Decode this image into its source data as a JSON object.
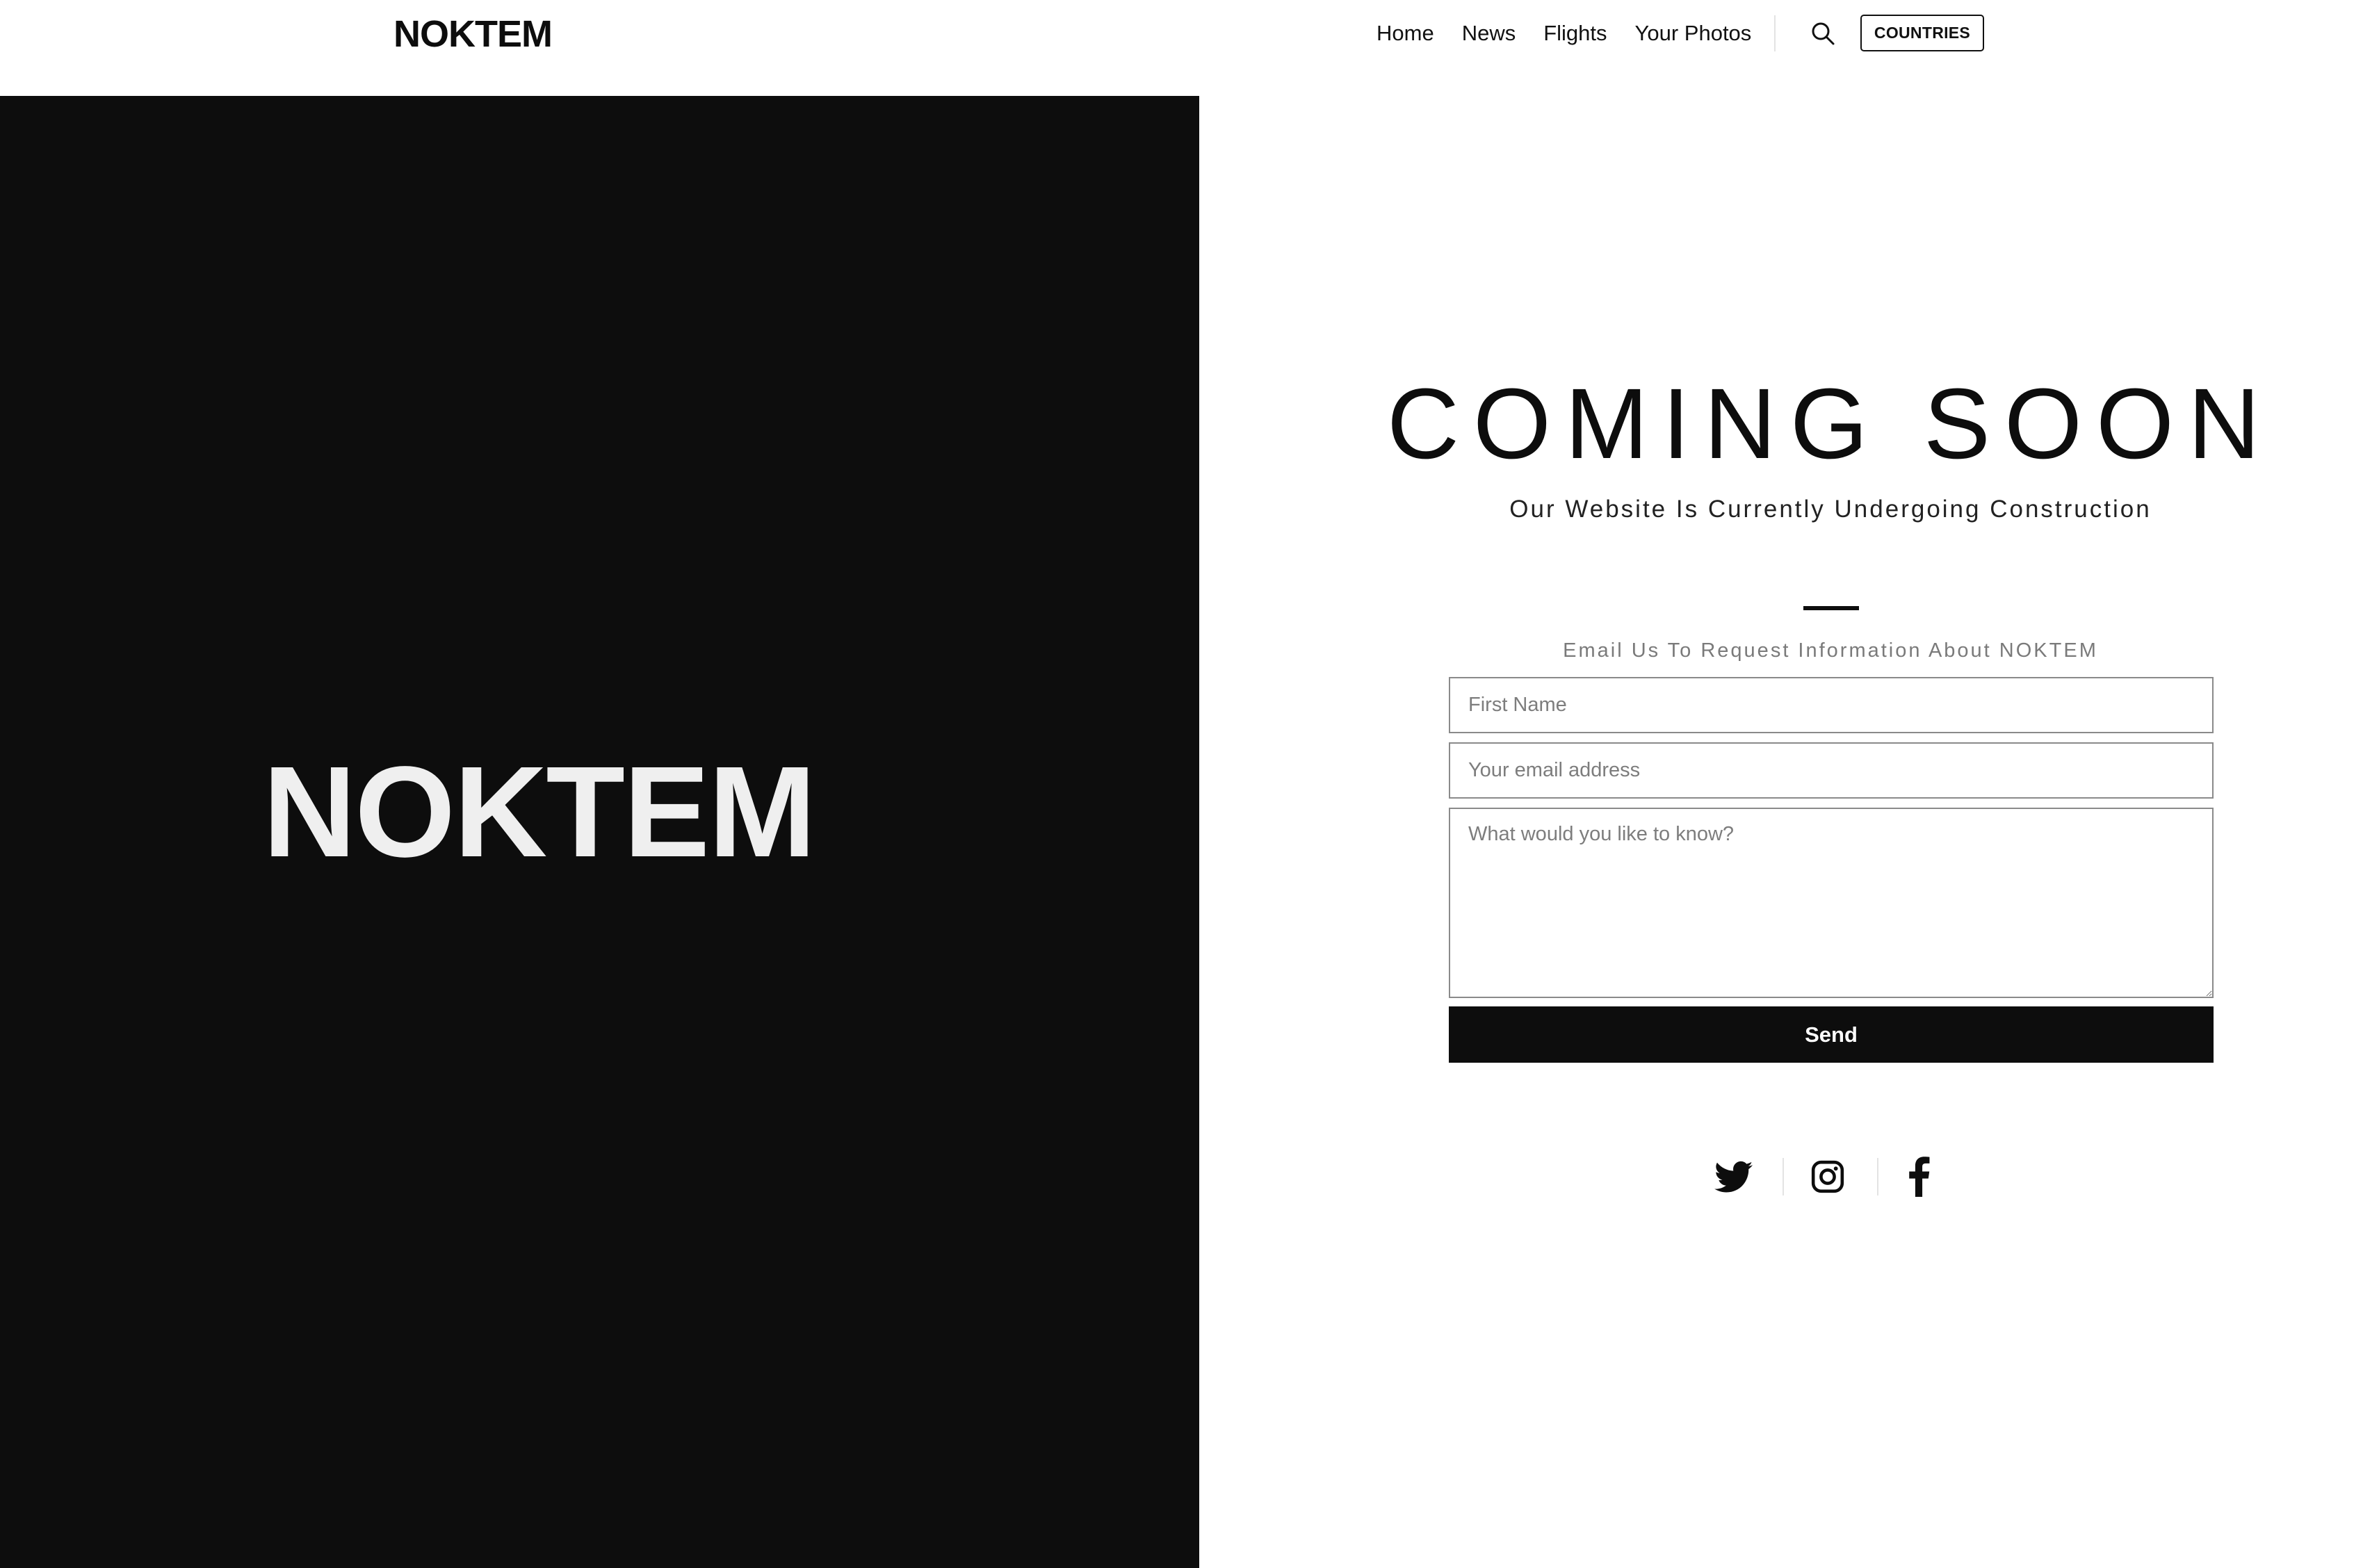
{
  "header": {
    "brand": "NOKTEM",
    "nav": [
      "Home",
      "News",
      "Flights",
      "Your Photos"
    ],
    "search_icon": "search-icon",
    "countries_label": "COUNTRIES"
  },
  "hero": {
    "brand": "NOKTEM",
    "panel_color": "#0d0d0d"
  },
  "main": {
    "title": "COMING SOON",
    "subtitle": "Our Website Is Currently Undergoing Construction",
    "email_prompt": "Email Us To Request Information About NOKTEM",
    "form": {
      "first_name_placeholder": "First Name",
      "email_placeholder": "Your email address",
      "message_placeholder": "What would you like to know?",
      "send_label": "Send"
    },
    "social": [
      "twitter-icon",
      "instagram-icon",
      "facebook-icon"
    ]
  }
}
